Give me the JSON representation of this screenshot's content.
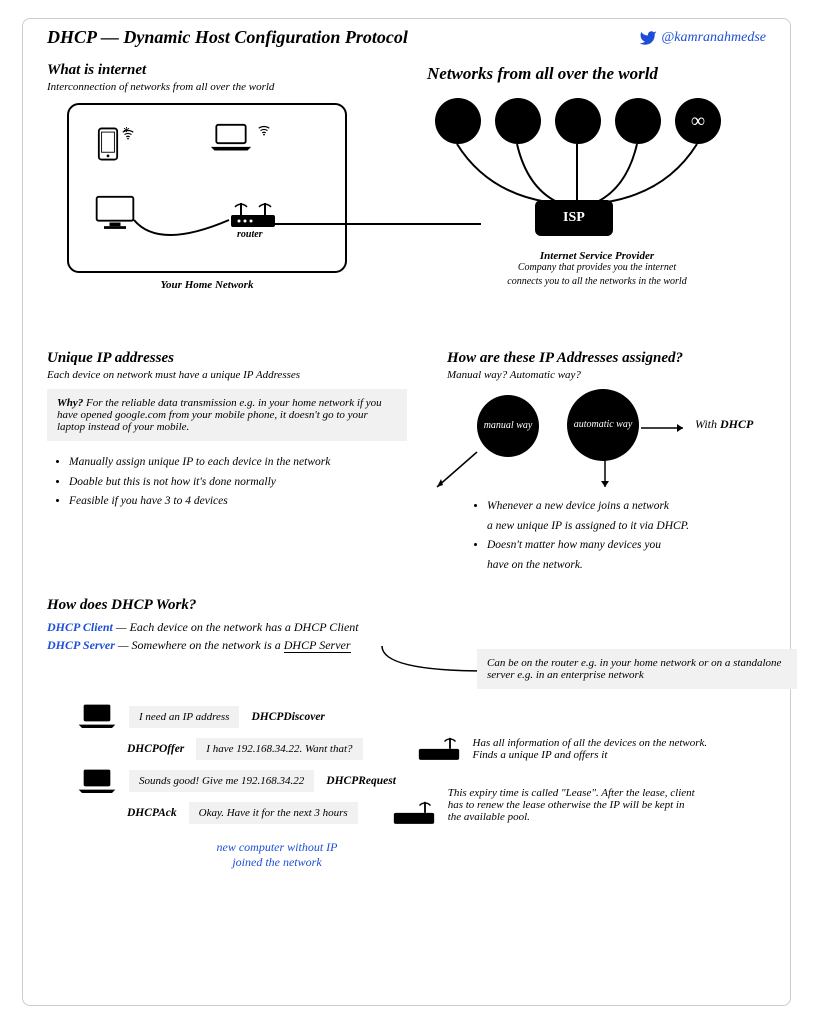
{
  "header": {
    "title": "DHCP — Dynamic Host Configuration Protocol",
    "handle": "@kamranahmedse"
  },
  "internet": {
    "heading": "What is internet",
    "sub": "Interconnection of networks from all over the world",
    "router_label": "router",
    "home_caption": "Your Home Network",
    "networks_heading": "Networks from all over the world",
    "infinity": "∞",
    "isp": "ISP",
    "isp_full": "Internet Service Provider",
    "isp_desc1": "Company that provides you the internet",
    "isp_desc2": "connects you to all the networks in the world"
  },
  "unique_ip": {
    "heading": "Unique IP addresses",
    "sub": "Each device on network must have a unique IP Addresses",
    "why_label": "Why?",
    "why_text": " For the reliable data transmission e.g. in your home network if you have opened google.com from your mobile phone, it doesn't go to your laptop instead of your mobile.",
    "bullet1": "Manually assign unique IP to each device in the network",
    "bullet2": "Doable but this is not how it's done normally",
    "bullet3": "Feasible if you have 3 to 4 devices"
  },
  "assigned": {
    "heading": "How are these IP Addresses assigned?",
    "sub": "Manual way? Automatic way?",
    "manual": "manual way",
    "automatic": "automatic way",
    "with_label": "With ",
    "with_dhcp": "DHCP",
    "bullet1a": "Whenever a new device joins a network",
    "bullet1b": "a new unique IP is assigned to it via DHCP.",
    "bullet2a": "Doesn't matter how many devices you",
    "bullet2b": "have on the network."
  },
  "how_works": {
    "heading": "How does DHCP Work?",
    "client_label": "DHCP Client",
    "client_text": " — Each device on the network has a DHCP Client",
    "server_label": "DHCP Server",
    "server_text": " — Somewhere on the network is a ",
    "server_underline": "DHCP Server",
    "note": "Can be on the router e.g. in your home network or on a standalone server e.g. in an enterprise network"
  },
  "messages": {
    "discover_msg": "I need an IP address",
    "discover_label": "DHCPDiscover",
    "offer_label": "DHCPOffer",
    "offer_msg": "I have 192.168.34.22. Want that?",
    "offer_note": "Has all information of all the devices on the network. Finds a unique IP and offers it",
    "request_msg": "Sounds good! Give me 192.168.34.22",
    "request_label": "DHCPRequest",
    "ack_label": "DHCPAck",
    "ack_msg": "Okay. Have it for the next 3 hours",
    "ack_note": "This expiry time is called \"Lease\". After the lease, client has to renew the lease otherwise the IP will be kept in the available pool.",
    "new_comp1": "new computer without IP",
    "new_comp2": "joined the network"
  }
}
